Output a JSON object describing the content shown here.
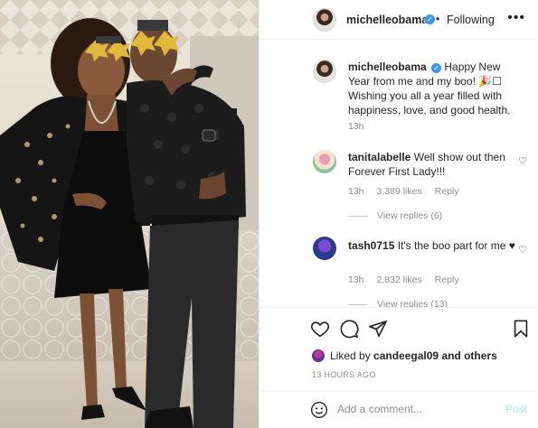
{
  "post": {
    "author": "michelleobama",
    "follow_status": "Following",
    "separator": "•",
    "more_glyph": "•••",
    "verified_glyph": "✓"
  },
  "caption": {
    "username": "michelleobama",
    "text": "Happy New Year from me and my boo! 🎉☐ Wishing you all a year filled with happiness, love, and good health.",
    "age": "13h"
  },
  "comments": [
    {
      "username": "tanitalabelle",
      "text": "Well show out then Forever First Lady!!!",
      "age": "13h",
      "likes": "3,389 likes",
      "reply_label": "Reply",
      "view_replies": "View replies (6)"
    },
    {
      "username": "tash0715",
      "text": "It's the boo part for me ♥",
      "age": "13h",
      "likes": "2,832 likes",
      "reply_label": "Reply",
      "view_replies": "View replies (13)"
    }
  ],
  "engagement": {
    "liked_by_prefix": "Liked by",
    "liked_by_user": "candeegal09",
    "liked_by_suffix": "and others",
    "timestamp": "13 HOURS AGO"
  },
  "composer": {
    "placeholder": "Add a comment...",
    "post_label": "Post"
  },
  "icons": {
    "like": "heart-icon",
    "comment": "comment-icon",
    "share": "share-icon",
    "save": "bookmark-icon",
    "emoji": "emoji-icon",
    "more": "more-icon",
    "verified": "verified-badge-icon"
  },
  "colors": {
    "text": "#262626",
    "muted": "#8e8e8e",
    "verified_blue": "#3897f0",
    "post_disabled": "#b2dffc",
    "divider": "#efefef"
  }
}
